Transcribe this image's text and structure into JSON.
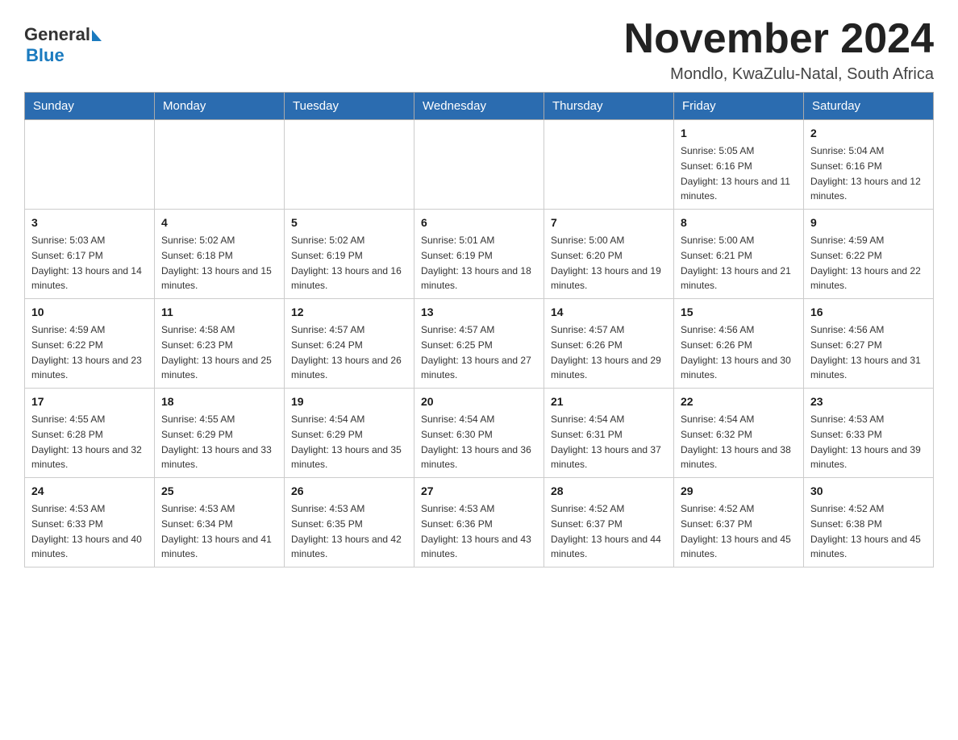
{
  "logo": {
    "general": "General",
    "blue": "Blue"
  },
  "title": "November 2024",
  "location": "Mondlo, KwaZulu-Natal, South Africa",
  "days_of_week": [
    "Sunday",
    "Monday",
    "Tuesday",
    "Wednesday",
    "Thursday",
    "Friday",
    "Saturday"
  ],
  "weeks": [
    [
      {
        "day": "",
        "info": ""
      },
      {
        "day": "",
        "info": ""
      },
      {
        "day": "",
        "info": ""
      },
      {
        "day": "",
        "info": ""
      },
      {
        "day": "",
        "info": ""
      },
      {
        "day": "1",
        "info": "Sunrise: 5:05 AM\nSunset: 6:16 PM\nDaylight: 13 hours and 11 minutes."
      },
      {
        "day": "2",
        "info": "Sunrise: 5:04 AM\nSunset: 6:16 PM\nDaylight: 13 hours and 12 minutes."
      }
    ],
    [
      {
        "day": "3",
        "info": "Sunrise: 5:03 AM\nSunset: 6:17 PM\nDaylight: 13 hours and 14 minutes."
      },
      {
        "day": "4",
        "info": "Sunrise: 5:02 AM\nSunset: 6:18 PM\nDaylight: 13 hours and 15 minutes."
      },
      {
        "day": "5",
        "info": "Sunrise: 5:02 AM\nSunset: 6:19 PM\nDaylight: 13 hours and 16 minutes."
      },
      {
        "day": "6",
        "info": "Sunrise: 5:01 AM\nSunset: 6:19 PM\nDaylight: 13 hours and 18 minutes."
      },
      {
        "day": "7",
        "info": "Sunrise: 5:00 AM\nSunset: 6:20 PM\nDaylight: 13 hours and 19 minutes."
      },
      {
        "day": "8",
        "info": "Sunrise: 5:00 AM\nSunset: 6:21 PM\nDaylight: 13 hours and 21 minutes."
      },
      {
        "day": "9",
        "info": "Sunrise: 4:59 AM\nSunset: 6:22 PM\nDaylight: 13 hours and 22 minutes."
      }
    ],
    [
      {
        "day": "10",
        "info": "Sunrise: 4:59 AM\nSunset: 6:22 PM\nDaylight: 13 hours and 23 minutes."
      },
      {
        "day": "11",
        "info": "Sunrise: 4:58 AM\nSunset: 6:23 PM\nDaylight: 13 hours and 25 minutes."
      },
      {
        "day": "12",
        "info": "Sunrise: 4:57 AM\nSunset: 6:24 PM\nDaylight: 13 hours and 26 minutes."
      },
      {
        "day": "13",
        "info": "Sunrise: 4:57 AM\nSunset: 6:25 PM\nDaylight: 13 hours and 27 minutes."
      },
      {
        "day": "14",
        "info": "Sunrise: 4:57 AM\nSunset: 6:26 PM\nDaylight: 13 hours and 29 minutes."
      },
      {
        "day": "15",
        "info": "Sunrise: 4:56 AM\nSunset: 6:26 PM\nDaylight: 13 hours and 30 minutes."
      },
      {
        "day": "16",
        "info": "Sunrise: 4:56 AM\nSunset: 6:27 PM\nDaylight: 13 hours and 31 minutes."
      }
    ],
    [
      {
        "day": "17",
        "info": "Sunrise: 4:55 AM\nSunset: 6:28 PM\nDaylight: 13 hours and 32 minutes."
      },
      {
        "day": "18",
        "info": "Sunrise: 4:55 AM\nSunset: 6:29 PM\nDaylight: 13 hours and 33 minutes."
      },
      {
        "day": "19",
        "info": "Sunrise: 4:54 AM\nSunset: 6:29 PM\nDaylight: 13 hours and 35 minutes."
      },
      {
        "day": "20",
        "info": "Sunrise: 4:54 AM\nSunset: 6:30 PM\nDaylight: 13 hours and 36 minutes."
      },
      {
        "day": "21",
        "info": "Sunrise: 4:54 AM\nSunset: 6:31 PM\nDaylight: 13 hours and 37 minutes."
      },
      {
        "day": "22",
        "info": "Sunrise: 4:54 AM\nSunset: 6:32 PM\nDaylight: 13 hours and 38 minutes."
      },
      {
        "day": "23",
        "info": "Sunrise: 4:53 AM\nSunset: 6:33 PM\nDaylight: 13 hours and 39 minutes."
      }
    ],
    [
      {
        "day": "24",
        "info": "Sunrise: 4:53 AM\nSunset: 6:33 PM\nDaylight: 13 hours and 40 minutes."
      },
      {
        "day": "25",
        "info": "Sunrise: 4:53 AM\nSunset: 6:34 PM\nDaylight: 13 hours and 41 minutes."
      },
      {
        "day": "26",
        "info": "Sunrise: 4:53 AM\nSunset: 6:35 PM\nDaylight: 13 hours and 42 minutes."
      },
      {
        "day": "27",
        "info": "Sunrise: 4:53 AM\nSunset: 6:36 PM\nDaylight: 13 hours and 43 minutes."
      },
      {
        "day": "28",
        "info": "Sunrise: 4:52 AM\nSunset: 6:37 PM\nDaylight: 13 hours and 44 minutes."
      },
      {
        "day": "29",
        "info": "Sunrise: 4:52 AM\nSunset: 6:37 PM\nDaylight: 13 hours and 45 minutes."
      },
      {
        "day": "30",
        "info": "Sunrise: 4:52 AM\nSunset: 6:38 PM\nDaylight: 13 hours and 45 minutes."
      }
    ]
  ]
}
